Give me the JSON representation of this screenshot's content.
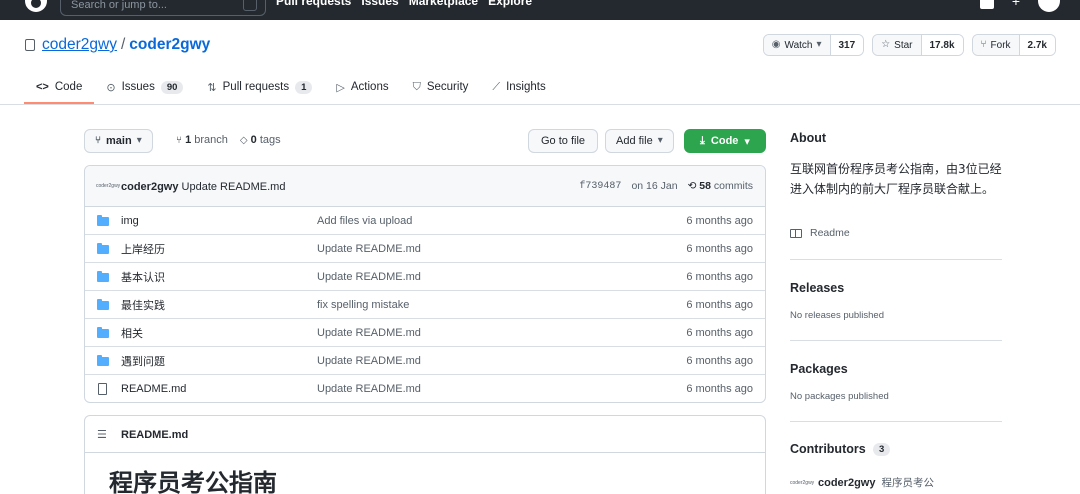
{
  "header": {
    "search_placeholder": "Search or jump to...",
    "nav": [
      "Pull requests",
      "Issues",
      "Marketplace",
      "Explore"
    ]
  },
  "repo": {
    "owner": "coder2gwy",
    "separator": "/",
    "name": "coder2gwy",
    "watch_label": "Watch",
    "watch_count": "317",
    "star_label": "Star",
    "star_count": "17.8k",
    "fork_label": "Fork",
    "fork_count": "2.7k"
  },
  "tabs": [
    {
      "label": "Code",
      "icon": "code-icon",
      "badge": ""
    },
    {
      "label": "Issues",
      "icon": "issue-icon",
      "badge": "90"
    },
    {
      "label": "Pull requests",
      "icon": "pr-icon",
      "badge": "1"
    },
    {
      "label": "Actions",
      "icon": "play-icon",
      "badge": ""
    },
    {
      "label": "Security",
      "icon": "shield-icon",
      "badge": ""
    },
    {
      "label": "Insights",
      "icon": "graph-icon",
      "badge": ""
    }
  ],
  "branch": {
    "current": "main",
    "branch_count": "1",
    "branch_label": "branch",
    "tag_count": "0",
    "tag_label": "tags",
    "go_to_file": "Go to file",
    "add_file": "Add file",
    "code": "Code"
  },
  "commit": {
    "avatar_text": "coder2gwy",
    "author": "coder2gwy",
    "message": "Update README.md",
    "sha": "f739487",
    "date": "on 16 Jan",
    "commit_count": "58",
    "commits_label": "commits"
  },
  "files": [
    {
      "name": "img",
      "type": "folder",
      "message": "Add files via upload",
      "age": "6 months ago"
    },
    {
      "name": "上岸经历",
      "type": "folder",
      "message": "Update README.md",
      "age": "6 months ago"
    },
    {
      "name": "基本认识",
      "type": "folder",
      "message": "Update README.md",
      "age": "6 months ago"
    },
    {
      "name": "最佳实践",
      "type": "folder",
      "message": "fix spelling mistake",
      "age": "6 months ago"
    },
    {
      "name": "相关",
      "type": "folder",
      "message": "Update README.md",
      "age": "6 months ago"
    },
    {
      "name": "遇到问题",
      "type": "folder",
      "message": "Update README.md",
      "age": "6 months ago"
    },
    {
      "name": "README.md",
      "type": "file",
      "message": "Update README.md",
      "age": "6 months ago"
    }
  ],
  "readme": {
    "filename": "README.md",
    "title": "程序员考公指南"
  },
  "sidebar": {
    "about_heading": "About",
    "about_description": "互联网首份程序员考公指南，由3位已经进入体制内的前大厂程序员联合献上。",
    "readme_link": "Readme",
    "releases_heading": "Releases",
    "releases_empty": "No releases published",
    "packages_heading": "Packages",
    "packages_empty": "No packages published",
    "contributors_heading": "Contributors",
    "contributors_count": "3",
    "contributor_login": "coder2gwy",
    "contributor_name": "程序员考公"
  },
  "colors": {
    "accent_link": "#0969da",
    "code_button": "#2da44e",
    "active_tab_underline": "#fd8c73",
    "folder": "#54aeff"
  }
}
